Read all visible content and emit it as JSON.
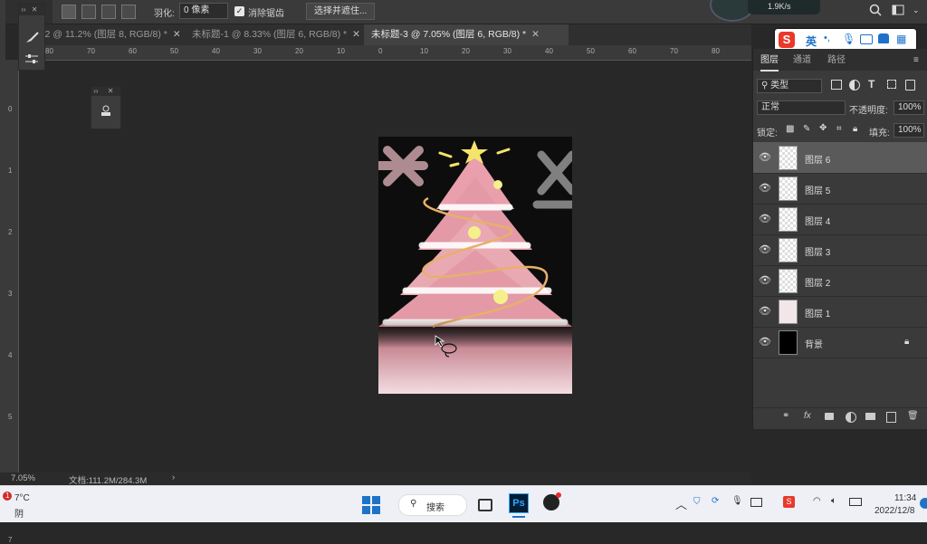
{
  "options_bar": {
    "feather_label": "羽化:",
    "feather_value": "0 像素",
    "antialias_label": "消除锯齿",
    "select_mask_button": "选择并遮住..."
  },
  "network_widget": {
    "speed": "1.9K/s"
  },
  "tabs": [
    {
      "label": "-2 @ 11.2% (图层 8, RGB/8) *",
      "active": false
    },
    {
      "label": "未标题-1 @ 8.33% (图层 6, RGB/8) *",
      "active": false
    },
    {
      "label": "未标题-3 @ 7.05% (图层 6, RGB/8) *",
      "active": true
    }
  ],
  "hruler_labels": [
    "80",
    "70",
    "60",
    "50",
    "40",
    "30",
    "20",
    "10",
    "0",
    "10",
    "20",
    "30",
    "40",
    "50",
    "60",
    "70",
    "80"
  ],
  "vruler_labels": [
    "0",
    "1",
    "2",
    "3",
    "4",
    "5",
    "6",
    "7"
  ],
  "ime_bar": {
    "lang": "英"
  },
  "layers_panel": {
    "tabs": [
      "图层",
      "通道",
      "路径"
    ],
    "filter_label": "类型",
    "blend_mode": "正常",
    "opacity_label": "不透明度:",
    "opacity_value": "100%",
    "lock_label": "锁定:",
    "fill_label": "填充:",
    "fill_value": "100%",
    "layers": [
      {
        "name": "图层 6",
        "selected": true
      },
      {
        "name": "图层 5",
        "selected": false
      },
      {
        "name": "图层 4",
        "selected": false
      },
      {
        "name": "图层 3",
        "selected": false
      },
      {
        "name": "图层 2",
        "selected": false
      },
      {
        "name": "图层 1",
        "selected": false
      },
      {
        "name": "背景",
        "selected": false,
        "locked": true
      }
    ]
  },
  "status_bar": {
    "zoom": "7.05%",
    "doc_info": "文档:111.2M/284.3M"
  },
  "taskbar": {
    "weather_temp": "7°C",
    "weather_desc": "阴",
    "weather_badge": "1",
    "search_label": "搜索",
    "time": "11:34",
    "date": "2022/12/8"
  },
  "colors": {
    "accent": "#1e72c8",
    "ps_blue": "#31a8ff",
    "tree_pink": "#e9a0ac"
  }
}
